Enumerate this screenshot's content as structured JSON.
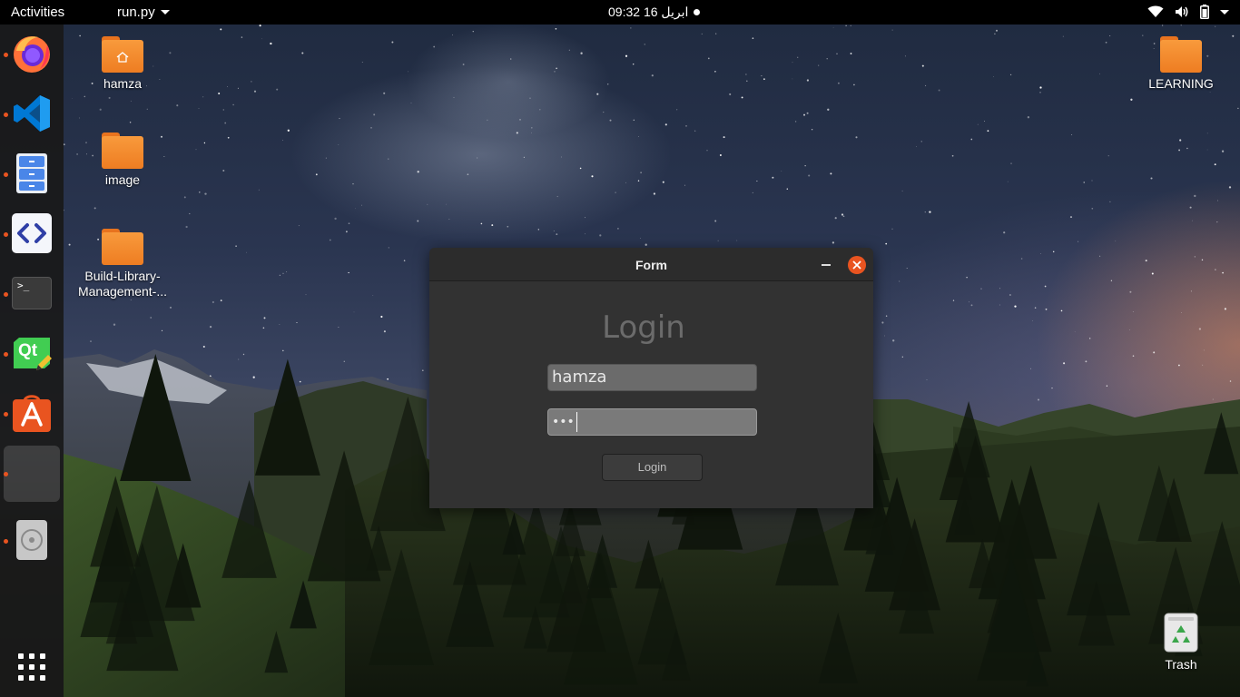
{
  "topbar": {
    "activities": "Activities",
    "app_menu": "run.py",
    "clock": "09:32  ابریل 16"
  },
  "dock": {
    "items": [
      {
        "name": "firefox",
        "running": true
      },
      {
        "name": "vscode",
        "running": true
      },
      {
        "name": "file-cabinet",
        "running": true
      },
      {
        "name": "code-editor",
        "running": true
      },
      {
        "name": "terminal",
        "running": true
      },
      {
        "name": "qt-creator",
        "running": true
      },
      {
        "name": "app-center",
        "running": true
      },
      {
        "name": "blank-app",
        "running": true
      },
      {
        "name": "disc",
        "running": true
      }
    ],
    "terminal_glyph": ">_",
    "qt_glyph": "Qt"
  },
  "desktop": {
    "icons": [
      {
        "label": "hamza"
      },
      {
        "label": "image"
      },
      {
        "label": "Build-Library-Management-..."
      },
      {
        "label": "LEARNING"
      },
      {
        "label": "Trash"
      }
    ]
  },
  "window": {
    "title": "Form",
    "heading": "Login",
    "username_value": "hamza",
    "password_mask": "•••",
    "login_button": "Login"
  },
  "colors": {
    "accent": "#e95420",
    "folder": "#f4892f",
    "window_bg": "#323232"
  }
}
